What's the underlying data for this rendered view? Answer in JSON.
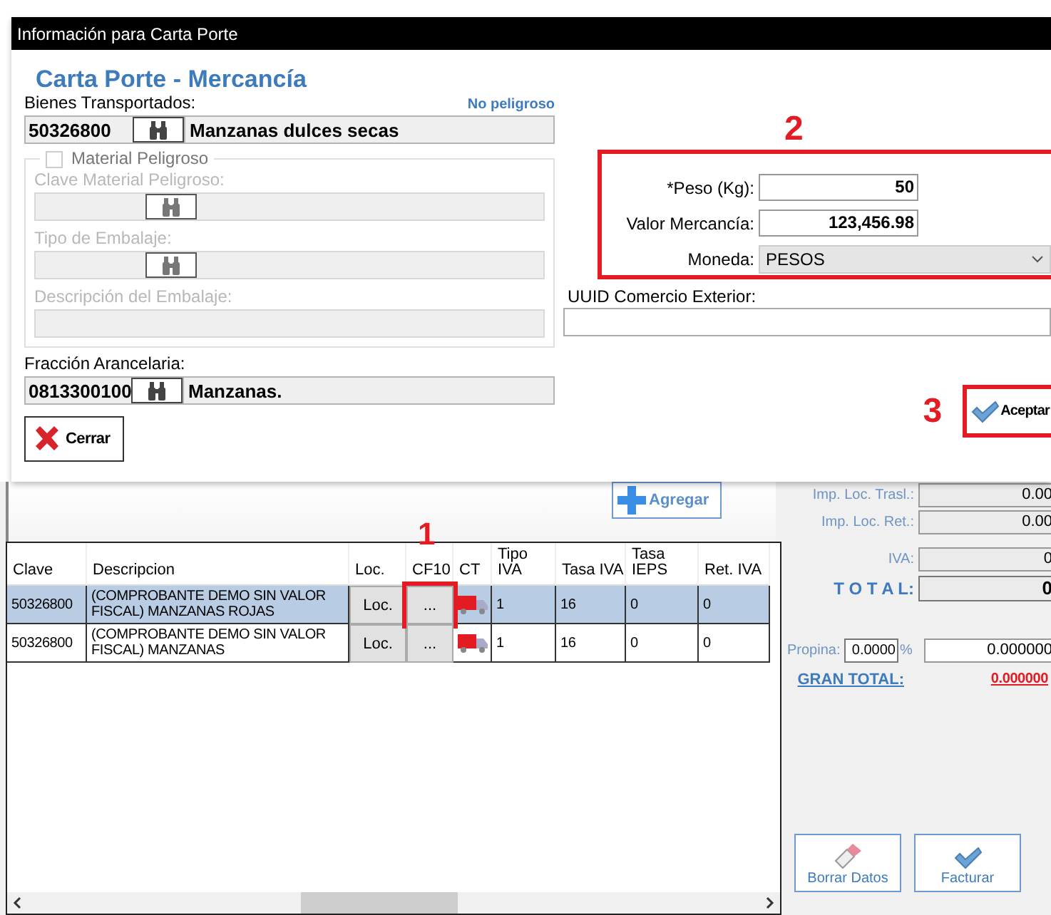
{
  "dialog": {
    "title": "Información para Carta Porte",
    "heading": "Carta Porte - Mercancía",
    "goods": {
      "label": "Bienes Transportados:",
      "hazard_status": "No peligroso",
      "code": "50326800",
      "description": "Manzanas dulces secas"
    },
    "hazardous": {
      "label": "Material Peligroso",
      "checked": false,
      "disabled": true,
      "fields": [
        {
          "label": "Clave Material Peligroso:",
          "kind": "lookup"
        },
        {
          "label": "Tipo de Embalaje:",
          "kind": "lookup"
        },
        {
          "label": "Descripción del Embalaje:",
          "kind": "text"
        }
      ]
    },
    "tariff": {
      "label": "Fracción Arancelaria:",
      "code": "0813300100",
      "description": "Manzanas."
    },
    "weight_annotation": "2",
    "weight": {
      "label": "*Peso (Kg):",
      "value": "50"
    },
    "value": {
      "label": "Valor Mercancía:",
      "value": "123,456.98"
    },
    "currency": {
      "label": "Moneda:",
      "value": "PESOS"
    },
    "uuid": {
      "label": "UUID Comercio Exterior:"
    },
    "close_button": "Cerrar",
    "accept_annotation": "3",
    "accept_button": "Aceptar"
  },
  "main": {
    "add_button": "Agregar",
    "table": {
      "columns": [
        "Clave",
        "Descripcion",
        "Loc.",
        "CF10",
        "CT",
        "Tipo IVA",
        "Tasa IVA",
        "Tasa IEPS",
        "Ret. IVA"
      ],
      "rows": [
        {
          "clave": "50326800",
          "descripcion": "(COMPROBANTE DEMO SIN VALOR FISCAL) MANZANAS ROJAS",
          "loc": "Loc.",
          "cfdi_annotation": "1",
          "cfdi": "...",
          "tipo_iva": "1",
          "tasa_iva": "16",
          "tasa_ieps": "0",
          "ret_iva": "0",
          "selected": true
        },
        {
          "clave": "50326800",
          "descripcion": "(COMPROBANTE DEMO SIN VALOR FISCAL) MANZANAS",
          "loc": "Loc.",
          "cfdi": "...",
          "tipo_iva": "1",
          "tasa_iva": "16",
          "tasa_ieps": "0",
          "ret_iva": "0",
          "selected": false
        }
      ]
    },
    "totals": {
      "imp_loc_trasl": {
        "label": "Imp. Loc. Trasl.:",
        "value": "0.00"
      },
      "imp_loc_ret": {
        "label": "Imp. Loc. Ret.:",
        "value": "0.00"
      },
      "iva": {
        "label": "IVA:",
        "value": "0"
      },
      "total": {
        "label": "T O T A L:",
        "value": "0"
      },
      "tip": {
        "label": "Propina:",
        "percent": "0.0000",
        "percent_sign": "%",
        "value": "0.000000"
      },
      "grand_total": {
        "label": "GRAN TOTAL:",
        "value": "0.000000"
      }
    },
    "clear_button": "Borrar Datos",
    "invoice_button": "Facturar"
  }
}
